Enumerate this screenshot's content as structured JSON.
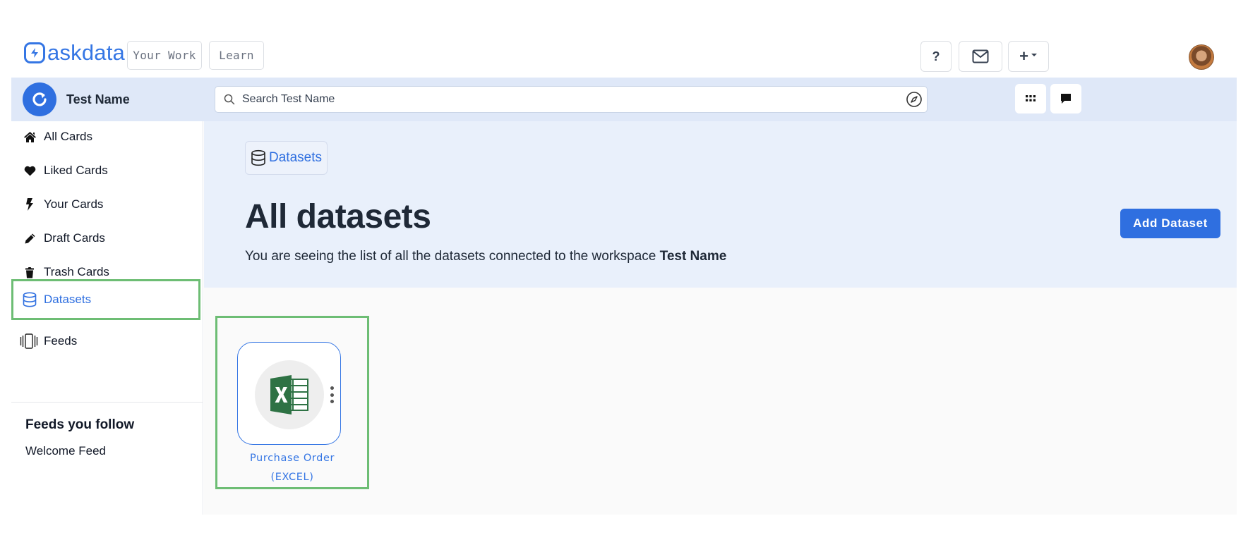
{
  "brand": {
    "name": "askdata",
    "color": "#3576e4"
  },
  "topnav": {
    "your_work": "Your Work",
    "learn": "Learn",
    "help_label": "?",
    "plus_label": "+"
  },
  "workspace": {
    "name": "Test Name",
    "search_placeholder": "Search Test Name"
  },
  "sidebar": {
    "items": [
      {
        "label": "All Cards",
        "icon": "home-icon"
      },
      {
        "label": "Liked Cards",
        "icon": "heart-icon"
      },
      {
        "label": "Your Cards",
        "icon": "bolt-icon"
      },
      {
        "label": "Draft Cards",
        "icon": "pencil-icon"
      },
      {
        "label": "Trash Cards",
        "icon": "trash-icon"
      },
      {
        "label": "Datasets",
        "icon": "database-icon",
        "active": true
      },
      {
        "label": "Feeds",
        "icon": "feeds-icon"
      }
    ],
    "follow_heading": "Feeds you follow",
    "follow_items": [
      "Welcome Feed"
    ]
  },
  "main": {
    "breadcrumb": "Datasets",
    "title": "All datasets",
    "subtitle_prefix": "You are seeing the list of all the datasets connected to the workspace",
    "subtitle_workspace": "Test Name",
    "add_button": "Add Dataset",
    "datasets": [
      {
        "name": "Purchase Order",
        "type": "(EXCEL)",
        "icon": "excel-icon"
      }
    ]
  },
  "colors": {
    "accent": "#2f6fe0",
    "highlight": "#6dbd74",
    "hero_bg": "#e9f0fb",
    "workspace_bar": "#dfe8f8"
  }
}
